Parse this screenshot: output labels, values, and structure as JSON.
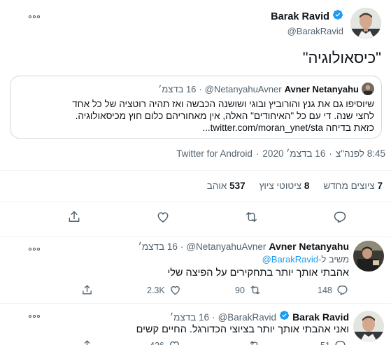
{
  "main_tweet": {
    "author_name": "Barak Ravid",
    "handle": "@BarakRavid",
    "text": "\"כיסאולוגיה\"",
    "quoted": {
      "author_name": "Avner Netanyahu",
      "handle": "@NetanyahuAvner",
      "date": "16 בדצמ׳",
      "separator": "·",
      "lines": [
        "שיוסיפו גם את גנץ והורוביץ ובוגי ושושנה הכבשה ואז תהיה רוטציה של כל אחד",
        "לחצי שנה. די עם כל \"האיחודים\" האלה, אין מאחוריהם כלום חוץ מכיסאולוגיה.",
        "כזאת בדיחה twitter.com/moran_ynet/sta..."
      ]
    },
    "meta": {
      "time": "8:45 לפנה\"צ",
      "date": "16 בדצמ׳ 2020",
      "source": "Twitter for Android",
      "separator": "·"
    },
    "stats": {
      "retweets_count": "7",
      "retweets_label": "ציוצים מחדש",
      "quotes_count": "8",
      "quotes_label": "ציטוטי ציוץ",
      "likes_count": "537",
      "likes_label": "אוהב"
    }
  },
  "replies": [
    {
      "author_name": "Avner Netanyahu",
      "handle": "@NetanyahuAvner",
      "date": "16 בדצמ׳",
      "separator": "·",
      "replying_prefix": "משיב ל-",
      "replying_handle": "@BarakRavid",
      "text": "אהבתי אותך יותר בתחקירים על הפיצה שלי",
      "replies_count": "148",
      "retweets_count": "90",
      "likes_count": "2.3K"
    },
    {
      "author_name": "Barak Ravid",
      "handle": "@BarakRavid",
      "date": "16 בדצמ׳",
      "separator": "·",
      "text": "ואני אהבתי אותך יותר בציוצי הכדורגל. החיים קשים",
      "replies_count": "51",
      "retweets_count": "",
      "likes_count": "426"
    }
  ],
  "colors": {
    "verified": "#1d9bf0",
    "link": "#1d9bf0",
    "secondary": "#536471",
    "divider": "#eff3f4"
  },
  "icons": [
    "more-icon",
    "verified-badge-icon",
    "reply-icon",
    "retweet-icon",
    "like-icon",
    "share-icon"
  ]
}
